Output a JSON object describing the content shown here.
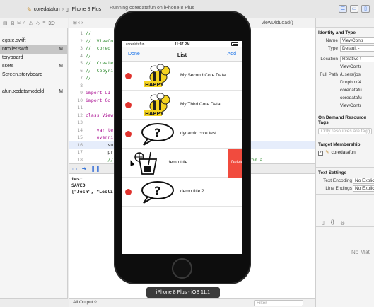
{
  "toolbar": {
    "scheme_project": "coredatafun",
    "scheme_device": "iPhone 8 Plus",
    "run_status": "Running coredatafun on iPhone 8 Plus"
  },
  "navigator": {
    "items": [
      {
        "label": "",
        "status": ""
      },
      {
        "label": "egate.swift",
        "status": ""
      },
      {
        "label": "ntroller.swift",
        "status": "M",
        "selected": true
      },
      {
        "label": "toryboard",
        "status": ""
      },
      {
        "label": "ssets",
        "status": "M"
      },
      {
        "label": "Screen.storyboard",
        "status": ""
      },
      {
        "label": "",
        "status": ""
      },
      {
        "label": "afun.xcdatamodeld",
        "status": "M"
      }
    ]
  },
  "editor": {
    "jump_crumb": "viewDidLoad()",
    "lines": [
      {
        "n": "1",
        "t": "//",
        "k": "cm"
      },
      {
        "n": "2",
        "t": "//  ViewCo",
        "k": "cm"
      },
      {
        "n": "3",
        "t": "//  cored",
        "k": "cm"
      },
      {
        "n": "4",
        "t": "//",
        "k": "cm"
      },
      {
        "n": "5",
        "t": "//  Create",
        "k": "cm"
      },
      {
        "n": "6",
        "t": "//  Copyri",
        "k": "cm"
      },
      {
        "n": "7",
        "t": "//",
        "k": "cm"
      },
      {
        "n": "8",
        "t": "",
        "k": ""
      },
      {
        "n": "9",
        "t": "import UI",
        "k": "kw"
      },
      {
        "n": "10",
        "t": "import Co",
        "k": "kw"
      },
      {
        "n": "11",
        "t": "",
        "k": ""
      },
      {
        "n": "12",
        "t": "class View",
        "k": "kw"
      },
      {
        "n": "13",
        "t": "",
        "k": ""
      },
      {
        "n": "14",
        "t": "    var te",
        "k": "kw"
      },
      {
        "n": "15",
        "t": "    overri",
        "k": "kw"
      },
      {
        "n": "16",
        "t": "        su",
        "k": ""
      },
      {
        "n": "17",
        "t": "        pr",
        "k": ""
      },
      {
        "n": "18",
        "t": "        //                                    , typically from a",
        "k": "cm"
      }
    ]
  },
  "console": {
    "output": "test\nSAVED\n[\"Josh\", \"Lesli"
  },
  "console_footer": {
    "output_selector": "All Output ◊",
    "filter_placeholder": "Filter"
  },
  "inspector": {
    "identity_title": "Identity and Type",
    "name_label": "Name",
    "name_value": "ViewContr",
    "type_label": "Type",
    "type_value": "Default -",
    "location_label": "Location",
    "location_value": "Relative t",
    "location_sub": "ViewContr",
    "fullpath_label": "Full Path",
    "fullpath_lines": [
      "/Users/jos",
      "Dropbox/4",
      "coredatafu",
      "coredatafu",
      "ViewContr"
    ],
    "odr_title": "On Demand Resource Tags",
    "odr_placeholder": "Only resources are tagg",
    "membership_title": "Target Membership",
    "membership_item": "coredatafun",
    "text_settings_title": "Text Settings",
    "encoding_label": "Text Encoding",
    "encoding_value": "No Explic",
    "endings_label": "Line Endings",
    "endings_value": "No Explic",
    "no_matches": "No Mat"
  },
  "simulator": {
    "carrier": "coredatafun",
    "time": "11:47 PM",
    "nav_left": "Done",
    "nav_title": "List",
    "nav_right": "Add",
    "cells": [
      {
        "label": "My Second Core Data",
        "thumb": "bee"
      },
      {
        "label": "My Third Core Data",
        "thumb": "bee"
      },
      {
        "label": "dynamic core test",
        "thumb": "speech-bubble"
      },
      {
        "label": "demo title",
        "thumb": "drink",
        "shifted": true,
        "delete_label": "Delete"
      },
      {
        "label": "demo title 2",
        "thumb": "speech-bubble"
      }
    ],
    "device_label": "iPhone 8 Plus - iOS 11.1"
  },
  "colors": {
    "accent": "#1a73e8",
    "delete_red": "#e0332e",
    "delete_button": "#f14b3e",
    "bee_yellow": "#f5d320"
  }
}
